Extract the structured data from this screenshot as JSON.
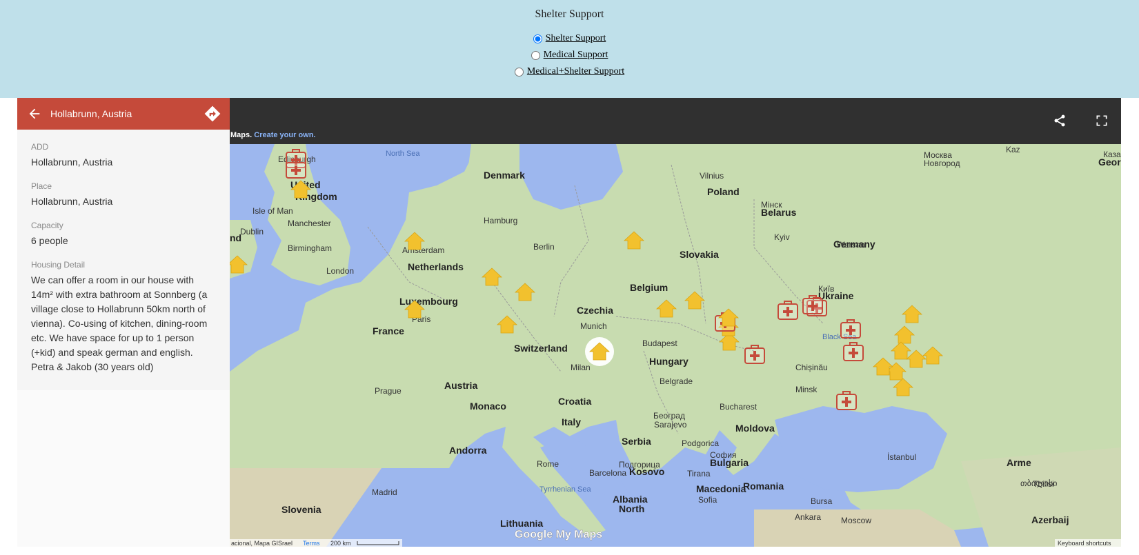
{
  "header": {
    "title": "Shelter Support",
    "options": [
      {
        "label": "Shelter Support",
        "checked": true
      },
      {
        "label": "Medical Support",
        "checked": false
      },
      {
        "label": "Medical+Shelter Support",
        "checked": false
      }
    ]
  },
  "panel": {
    "title": "Hollabrunn, Austria",
    "fields": [
      {
        "key": "ADD",
        "value": "Hollabrunn, Austria"
      },
      {
        "key": "Place",
        "value": "Hollabrunn, Austria"
      },
      {
        "key": "Capacity",
        "value": "6 people"
      },
      {
        "key": "Housing Detail",
        "value": "We can offer a room in our house with 14m² with extra bathroom at Sonnberg (a village close to Hollabrunn 50km north of vienna). Co-using of kitchen, dining-room etc. We have space for up to 1 person (+kid) and speak german and english. Petra & Jakob (30 years old)"
      }
    ],
    "header_color": "#c54a3a"
  },
  "map": {
    "credit_prefix": "Maps.",
    "credit_link": "Create your own.",
    "logo": "Google My Maps",
    "attribution": "acional, Mapa GISrael",
    "terms": "Terms",
    "scale": "200 km",
    "shortcuts": "Keyboard shortcuts",
    "colors": {
      "land": "#c8dcb0",
      "water": "#9db7ee",
      "shelter_marker": "#f2c12e",
      "medical_marker": "#c54a3a"
    },
    "labels": [
      {
        "t": "North Sea",
        "type": "sea"
      },
      {
        "t": "Edinburgh",
        "type": "city"
      },
      {
        "t": "United",
        "type": "country"
      },
      {
        "t": "Kingdom",
        "type": "country"
      },
      {
        "t": "Isle of Man",
        "type": "city"
      },
      {
        "t": "Dublin",
        "type": "city"
      },
      {
        "t": "nd",
        "type": "country"
      },
      {
        "t": "Manchester",
        "type": "city"
      },
      {
        "t": "Birmingham",
        "type": "city"
      },
      {
        "t": "London",
        "type": "city"
      },
      {
        "t": "Denmark",
        "type": "country"
      },
      {
        "t": "Hamburg",
        "type": "city"
      },
      {
        "t": "Amsterdam",
        "type": "city"
      },
      {
        "t": "Netherlands",
        "type": "country"
      },
      {
        "t": "Berlin",
        "type": "city"
      },
      {
        "t": "Germany",
        "type": "country"
      },
      {
        "t": "Belgium",
        "type": "country"
      },
      {
        "t": "Luxembourg",
        "type": "country"
      },
      {
        "t": "Paris",
        "type": "city"
      },
      {
        "t": "France",
        "type": "country"
      },
      {
        "t": "Prague",
        "type": "city"
      },
      {
        "t": "Czechia",
        "type": "country"
      },
      {
        "t": "Munich",
        "type": "city"
      },
      {
        "t": "Switzerland",
        "type": "country"
      },
      {
        "t": "Austria",
        "type": "country"
      },
      {
        "t": "Milan",
        "type": "city"
      },
      {
        "t": "Monaco",
        "type": "country"
      },
      {
        "t": "Andorra",
        "type": "country"
      },
      {
        "t": "Barcelona",
        "type": "city"
      },
      {
        "t": "Madrid",
        "type": "city"
      },
      {
        "t": "Slovenia",
        "type": "country"
      },
      {
        "t": "Croatia",
        "type": "country"
      },
      {
        "t": "Italy",
        "type": "country"
      },
      {
        "t": "Rome",
        "type": "city"
      },
      {
        "t": "Tyrrhenian Sea",
        "type": "sea"
      },
      {
        "t": "Lithuania",
        "type": "country"
      },
      {
        "t": "Vilnius",
        "type": "city"
      },
      {
        "t": "Poland",
        "type": "country"
      },
      {
        "t": "Warsaw",
        "type": "city"
      },
      {
        "t": "Slovakia",
        "type": "country"
      },
      {
        "t": "Budapest",
        "type": "city"
      },
      {
        "t": "Hungary",
        "type": "country"
      },
      {
        "t": "Belgrade",
        "type": "city"
      },
      {
        "t": "Београд",
        "type": "city"
      },
      {
        "t": "Sarajevo",
        "type": "city"
      },
      {
        "t": "Serbia",
        "type": "country"
      },
      {
        "t": "Podgorica",
        "type": "city"
      },
      {
        "t": "Подгорица",
        "type": "city"
      },
      {
        "t": "Kosovo",
        "type": "country"
      },
      {
        "t": "Tirana",
        "type": "city"
      },
      {
        "t": "Albania",
        "type": "country"
      },
      {
        "t": "North",
        "type": "country"
      },
      {
        "t": "Macedonia",
        "type": "country"
      },
      {
        "t": "Sofia",
        "type": "city"
      },
      {
        "t": "София",
        "type": "city"
      },
      {
        "t": "Bulgaria",
        "type": "country"
      },
      {
        "t": "Romania",
        "type": "country"
      },
      {
        "t": "Bucharest",
        "type": "city"
      },
      {
        "t": "Moldova",
        "type": "country"
      },
      {
        "t": "Chișinău",
        "type": "city"
      },
      {
        "t": "Minsk",
        "type": "city"
      },
      {
        "t": "Мінск",
        "type": "city"
      },
      {
        "t": "Belarus",
        "type": "country"
      },
      {
        "t": "Kyiv",
        "type": "city"
      },
      {
        "t": "Київ",
        "type": "city"
      },
      {
        "t": "Ukraine",
        "type": "country"
      },
      {
        "t": "Black Sea",
        "type": "sea"
      },
      {
        "t": "İstanbul",
        "type": "city"
      },
      {
        "t": "Bursa",
        "type": "city"
      },
      {
        "t": "Ankara",
        "type": "city"
      },
      {
        "t": "Moscow",
        "type": "city"
      },
      {
        "t": "Москва",
        "type": "city"
      },
      {
        "t": "Новгород",
        "type": "city"
      },
      {
        "t": "Kaz",
        "type": "city"
      },
      {
        "t": "Каза",
        "type": "city"
      },
      {
        "t": "Georgia",
        "type": "country"
      },
      {
        "t": "თბილისი",
        "type": "city"
      },
      {
        "t": "Tbilisi",
        "type": "city"
      },
      {
        "t": "Arme",
        "type": "country"
      },
      {
        "t": "Azerbaij",
        "type": "country"
      }
    ],
    "markers": [
      {
        "kind": "medical"
      },
      {
        "kind": "medical"
      },
      {
        "kind": "shelter"
      },
      {
        "kind": "shelter"
      },
      {
        "kind": "shelter"
      },
      {
        "kind": "shelter"
      },
      {
        "kind": "shelter"
      },
      {
        "kind": "shelter"
      },
      {
        "kind": "shelter"
      },
      {
        "kind": "shelter"
      },
      {
        "kind": "shelter",
        "selected": true
      },
      {
        "kind": "shelter"
      },
      {
        "kind": "shelter"
      },
      {
        "kind": "shelter"
      },
      {
        "kind": "shelter"
      },
      {
        "kind": "medical"
      },
      {
        "kind": "shelter"
      },
      {
        "kind": "medical"
      },
      {
        "kind": "medical"
      },
      {
        "kind": "medical"
      },
      {
        "kind": "medical"
      },
      {
        "kind": "medical"
      },
      {
        "kind": "medical"
      },
      {
        "kind": "shelter"
      },
      {
        "kind": "shelter"
      },
      {
        "kind": "shelter"
      },
      {
        "kind": "shelter"
      },
      {
        "kind": "shelter"
      },
      {
        "kind": "shelter"
      },
      {
        "kind": "shelter"
      },
      {
        "kind": "medical"
      },
      {
        "kind": "shelter"
      }
    ]
  }
}
